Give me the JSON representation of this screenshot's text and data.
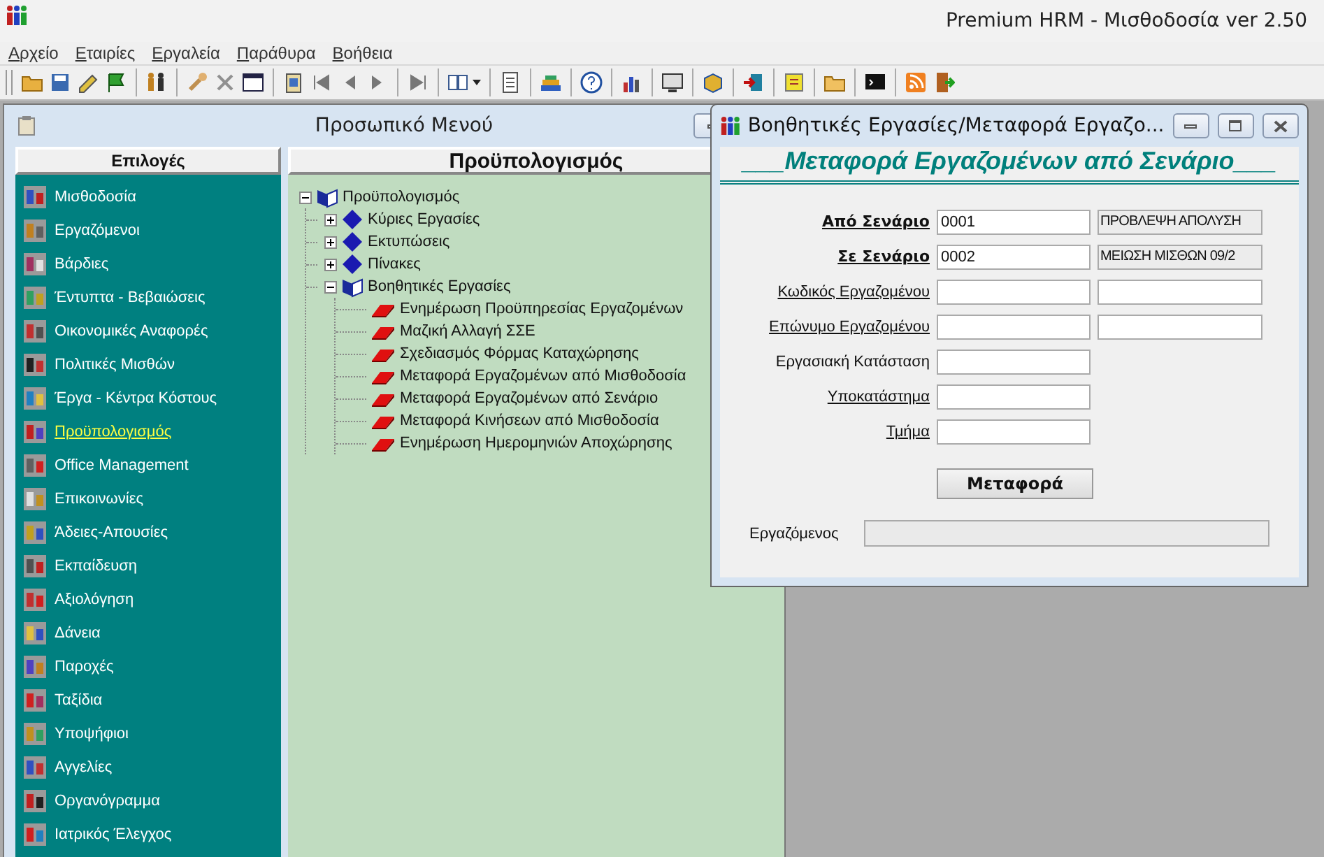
{
  "app": {
    "title": "Premium HRM - Μισθοδοσία ver 2.50"
  },
  "menu": [
    "Αρχείο",
    "Εταιρίες",
    "Εργαλεία",
    "Παράθυρα",
    "Βοήθεια"
  ],
  "personal_menu": {
    "title": "Προσωπικό Μενού",
    "options_header": "Επιλογές",
    "options": [
      {
        "label": "Μισθοδοσία",
        "selected": false
      },
      {
        "label": "Εργαζόμενοι",
        "selected": false
      },
      {
        "label": "Βάρδιες",
        "selected": false
      },
      {
        "label": "Έντυπτα - Βεβαιώσεις",
        "selected": false
      },
      {
        "label": "Οικονομικές Αναφορές",
        "selected": false
      },
      {
        "label": "Πολιτικές Μισθών",
        "selected": false
      },
      {
        "label": "Έργα - Κέντρα Κόστους",
        "selected": false
      },
      {
        "label": "Προϋπολογισμός",
        "selected": true
      },
      {
        "label": "Office Management",
        "selected": false
      },
      {
        "label": "Επικοινωνίες",
        "selected": false
      },
      {
        "label": "Άδειες-Απουσίες",
        "selected": false
      },
      {
        "label": "Εκπαίδευση",
        "selected": false
      },
      {
        "label": "Αξιολόγηση",
        "selected": false
      },
      {
        "label": "Δάνεια",
        "selected": false
      },
      {
        "label": "Παροχές",
        "selected": false
      },
      {
        "label": "Ταξίδια",
        "selected": false
      },
      {
        "label": "Υποψήφιοι",
        "selected": false
      },
      {
        "label": "Αγγελίες",
        "selected": false
      },
      {
        "label": "Οργανόγραμμα",
        "selected": false
      },
      {
        "label": "Ιατρικός Έλεγχος",
        "selected": false
      }
    ],
    "tree_header": "Προϋπολογισμός",
    "tree": [
      {
        "label": "Προϋπολογισμός",
        "kind": "book",
        "expanded": true,
        "children": [
          {
            "label": "Κύριες Εργασίες",
            "kind": "diamond",
            "expanded": false
          },
          {
            "label": "Εκτυπώσεις",
            "kind": "diamond",
            "expanded": false
          },
          {
            "label": "Πίνακες",
            "kind": "diamond",
            "expanded": false
          },
          {
            "label": "Βοηθητικές Εργασίες",
            "kind": "book",
            "expanded": true,
            "children": [
              {
                "label": "Ενημέρωση Προϋπηρεσίας Εργαζομένων",
                "kind": "task"
              },
              {
                "label": "Μαζική Αλλαγή ΣΣΕ",
                "kind": "task"
              },
              {
                "label": "Σχεδιασμός Φόρμας Καταχώρησης",
                "kind": "task"
              },
              {
                "label": "Μεταφορά Εργαζομένων από Μισθοδοσία",
                "kind": "task"
              },
              {
                "label": "Μεταφορά Εργαζομένων από Σενάριο",
                "kind": "task"
              },
              {
                "label": "Μεταφορά Κινήσεων από Μισθοδοσία",
                "kind": "task"
              },
              {
                "label": "Ενημέρωση Ημερομηνιών Αποχώρησης",
                "kind": "task"
              }
            ]
          }
        ]
      }
    ]
  },
  "dialog": {
    "title": "Βοηθητικές Εργασίες/Μεταφορά Εργαζο...",
    "heading": "___Μεταφορά Εργαζομένων από Σενάριο___",
    "fields": [
      {
        "label": "Από Σενάριο",
        "kind": "required",
        "value": "0001",
        "description": {
          "value": "ΠΡΟΒΛΕΨΗ ΑΠΟΛΥΣΗ",
          "disabled": true
        }
      },
      {
        "label": "Σε Σενάριο",
        "kind": "required",
        "value": "0002",
        "description": {
          "value": "ΜΕΙΩΣΗ ΜΙΣΘΩΝ 09/2",
          "disabled": true
        }
      },
      {
        "label": "Κωδικός Εργαζομένου",
        "kind": "lookup",
        "description": {
          "disabled": false
        }
      },
      {
        "label": "Επώνυμο Εργαζομένου",
        "kind": "lookup",
        "description": {
          "disabled": false
        }
      },
      {
        "label": "Εργασιακή Κατάσταση",
        "kind": "plain"
      },
      {
        "label": "Υποκατάστημα",
        "kind": "lookup"
      },
      {
        "label": "Τμήμα",
        "kind": "lookup"
      }
    ],
    "button": "Μεταφορά",
    "employee_label": "Εργαζόμενος"
  }
}
